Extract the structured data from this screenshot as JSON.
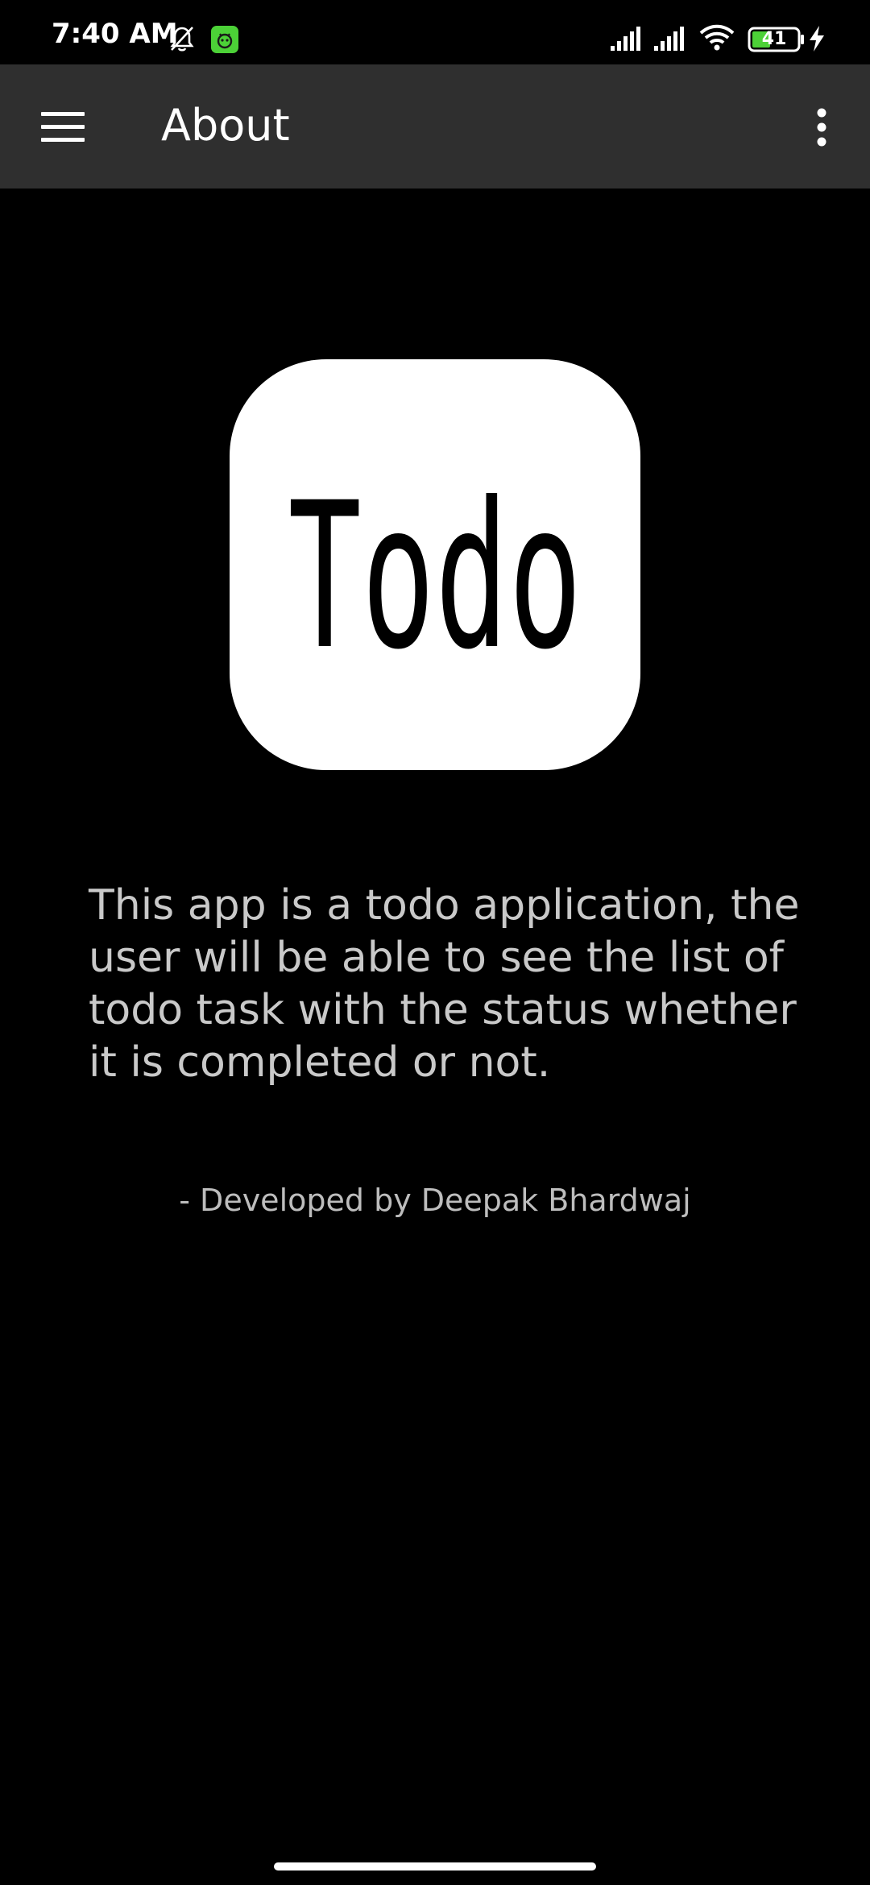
{
  "status_bar": {
    "time": "7:40 AM",
    "battery_level": "41",
    "icons": [
      "bell-muted-icon",
      "app-notification-icon",
      "signal-icon",
      "signal-icon",
      "wifi-icon",
      "battery-icon",
      "charging-icon"
    ]
  },
  "app_bar": {
    "title": "About",
    "menu_icon": "hamburger-menu-icon",
    "overflow_icon": "more-vert-icon"
  },
  "logo": {
    "text": "Todo",
    "background": "#ffffff",
    "text_color": "#000000"
  },
  "content": {
    "description": "This app is a todo application, the user will be able to see the list of todo task with the status whether it is completed or not.",
    "credit": "- Developed by Deepak Bhardwaj"
  },
  "colors": {
    "background": "#000000",
    "app_bar": "#2f2f2f",
    "text_primary": "#ffffff",
    "text_secondary": "#c9c9c9",
    "notification_accent": "#4cd137"
  }
}
